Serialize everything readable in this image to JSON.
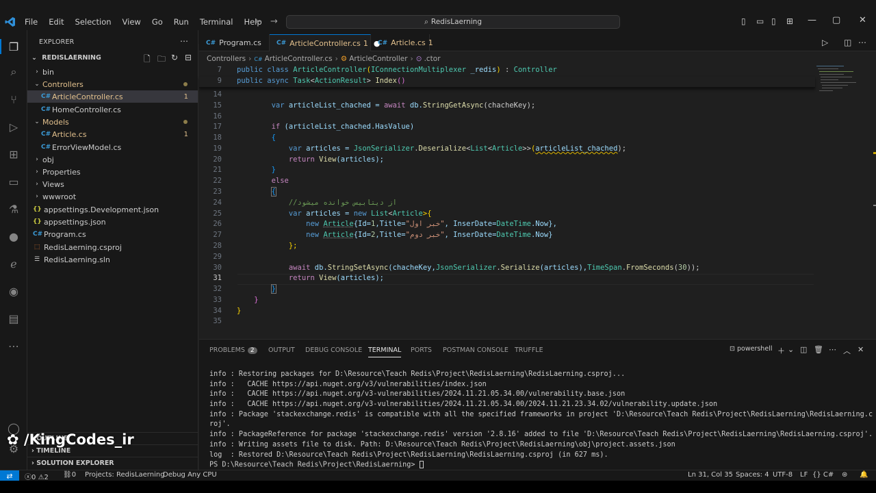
{
  "titlebar": {
    "menu": [
      "File",
      "Edit",
      "Selection",
      "View",
      "Go",
      "Run",
      "Terminal",
      "Help"
    ],
    "search": "RedisLaerning"
  },
  "sidebar": {
    "title": "EXPLORER",
    "project": "REDISLAERNING",
    "items": [
      {
        "label": "bin",
        "type": "folder",
        "open": false
      },
      {
        "label": "Controllers",
        "type": "folder",
        "open": true,
        "modified": true
      },
      {
        "label": "ArticleController.cs",
        "type": "cs",
        "badge": "1",
        "selected": true
      },
      {
        "label": "HomeController.cs",
        "type": "cs"
      },
      {
        "label": "Models",
        "type": "folder",
        "open": true,
        "modified": true
      },
      {
        "label": "Article.cs",
        "type": "cs",
        "badge": "1"
      },
      {
        "label": "ErrorViewModel.cs",
        "type": "cs"
      },
      {
        "label": "obj",
        "type": "folder",
        "open": false
      },
      {
        "label": "Properties",
        "type": "folder",
        "open": false
      },
      {
        "label": "Views",
        "type": "folder",
        "open": false
      },
      {
        "label": "wwwroot",
        "type": "folder",
        "open": false
      },
      {
        "label": "appsettings.Development.json",
        "type": "json"
      },
      {
        "label": "appsettings.json",
        "type": "json"
      },
      {
        "label": "Program.cs",
        "type": "cs"
      },
      {
        "label": "RedisLaerning.csproj",
        "type": "csproj"
      },
      {
        "label": "RedisLaerning.sln",
        "type": "sln"
      }
    ],
    "sections": [
      "OUTLINE",
      "TIMELINE",
      "SOLUTION EXPLORER"
    ]
  },
  "tabs": [
    {
      "label": "Program.cs",
      "badge": ""
    },
    {
      "label": "ArticleController.cs",
      "badge": "1"
    },
    {
      "label": "Article.cs",
      "badge": "1"
    }
  ],
  "breadcrumb": [
    "Controllers",
    "ArticleController.cs",
    "ArticleController",
    ".ctor"
  ],
  "editor": {
    "sticky": [
      {
        "n": "7",
        "code": "public class ArticleController(IConnectionMultiplexer _redis) : Controller"
      },
      {
        "n": "9",
        "code": "    public async Task<ActionResult> Index()"
      }
    ],
    "line_numbers": [
      "14",
      "15",
      "16",
      "17",
      "18",
      "19",
      "20",
      "21",
      "22",
      "23",
      "24",
      "25",
      "26",
      "27",
      "28",
      "29",
      "30",
      "31",
      "32",
      "33",
      "34",
      "35"
    ],
    "current_line": "31",
    "code_text": {
      "l15a": "var",
      "l15b": " articleList_chached = ",
      "l15c": "await",
      "l15d": " db.",
      "l15e": "StringGetAsync",
      "l15f": "(chacheKey);",
      "l17a": "if",
      "l17b": " (articleList_chached.HasValue)",
      "l19a": "var",
      "l19b": " articles = ",
      "l19c": "JsonSerializer",
      "l19d": ".",
      "l19e": "Deserialize",
      "l19f": "<",
      "l19g": "List",
      "l19h": "<",
      "l19i": "Article",
      "l19j": ">>",
      "l19k": "(",
      "l19l": "articleList_chached",
      "l19m": ");",
      "l20a": "return",
      "l20b": " ",
      "l20c": "View",
      "l20d": "(articles);",
      "l22": "else",
      "l24": "//از دیتابیس خوانده میشود",
      "l25a": "var",
      "l25b": " articles = ",
      "l25c": "new",
      "l25d": " ",
      "l25e": "List",
      "l25f": "<",
      "l25g": "Article",
      "l25h": ">{",
      "l26a": "new",
      "l26b": " ",
      "l26c": "Article",
      "l26d": "{Id=",
      "l26e": "1",
      "l26f": ",Title=",
      "l26g": "\"خبر اول\"",
      "l26h": ", InserDate=",
      "l26i": "DateTime",
      "l26j": ".Now},",
      "l27a": "new",
      "l27b": " ",
      "l27c": "Article",
      "l27d": "{Id=",
      "l27e": "2",
      "l27f": ",Title=",
      "l27g": "\"خبر دوم\"",
      "l27h": ", InserDate=",
      "l27i": "DateTime",
      "l27j": ".Now}",
      "l28": "};",
      "l30a": "await",
      "l30b": " db.",
      "l30c": "StringSetAsync",
      "l30d": "(chacheKey,",
      "l30e": "JsonSerializer",
      "l30f": ".",
      "l30g": "Serialize",
      "l30h": "(articles),",
      "l30i": "TimeSpan",
      "l30j": ".",
      "l30k": "FromSeconds",
      "l30l": "(",
      "l30m": "30",
      "l30n": "));",
      "l31a": "return",
      "l31b": " ",
      "l31c": "View",
      "l31d": "(articles);"
    }
  },
  "panel": {
    "tabs": [
      "PROBLEMS",
      "OUTPUT",
      "DEBUG CONSOLE",
      "TERMINAL",
      "PORTS",
      "POSTMAN CONSOLE",
      "TRUFFLE"
    ],
    "problems_count": "2",
    "shell": "powershell",
    "terminal": [
      "info : Restoring packages for D:\\Resource\\Teach Redis\\Project\\RedisLaerning\\RedisLaerning.csproj...",
      "info :   CACHE https://api.nuget.org/v3/vulnerabilities/index.json",
      "info :   CACHE https://api.nuget.org/v3-vulnerabilities/2024.11.21.05.34.00/vulnerability.base.json",
      "info :   CACHE https://api.nuget.org/v3-vulnerabilities/2024.11.21.05.34.00/2024.11.21.23.34.02/vulnerability.update.json",
      "info : Package 'stackexchange.redis' is compatible with all the specified frameworks in project 'D:\\Resource\\Teach Redis\\Project\\RedisLaerning\\RedisLaerning.csp",
      "roj'.",
      "info : PackageReference for package 'stackexchange.redis' version '2.8.16' added to file 'D:\\Resource\\Teach Redis\\Project\\RedisLaerning\\RedisLaerning.csproj'.",
      "info : Writing assets file to disk. Path: D:\\Resource\\Teach Redis\\Project\\RedisLaerning\\obj\\project.assets.json",
      "log  : Restored D:\\Resource\\Teach Redis\\Project\\RedisLaerning\\RedisLaerning.csproj (in 627 ms).",
      "PS D:\\Resource\\Teach Redis\\Project\\RedisLaerning> "
    ]
  },
  "statusbar": {
    "errors": "0",
    "warnings": "2",
    "ports": "0",
    "project": "Projects: RedisLaerning",
    "debug": "Debug Any CPU",
    "position": "Ln 31, Col 35",
    "spaces": "Spaces: 4",
    "encoding": "UTF-8",
    "eol": "LF",
    "language": "C#"
  },
  "watermark": "/KingCodes_ir",
  "colors": {
    "accent": "#0078d4",
    "keyword": "#569cd6",
    "type": "#4ec9b0",
    "string": "#ce9178",
    "comment": "#6a9955"
  }
}
